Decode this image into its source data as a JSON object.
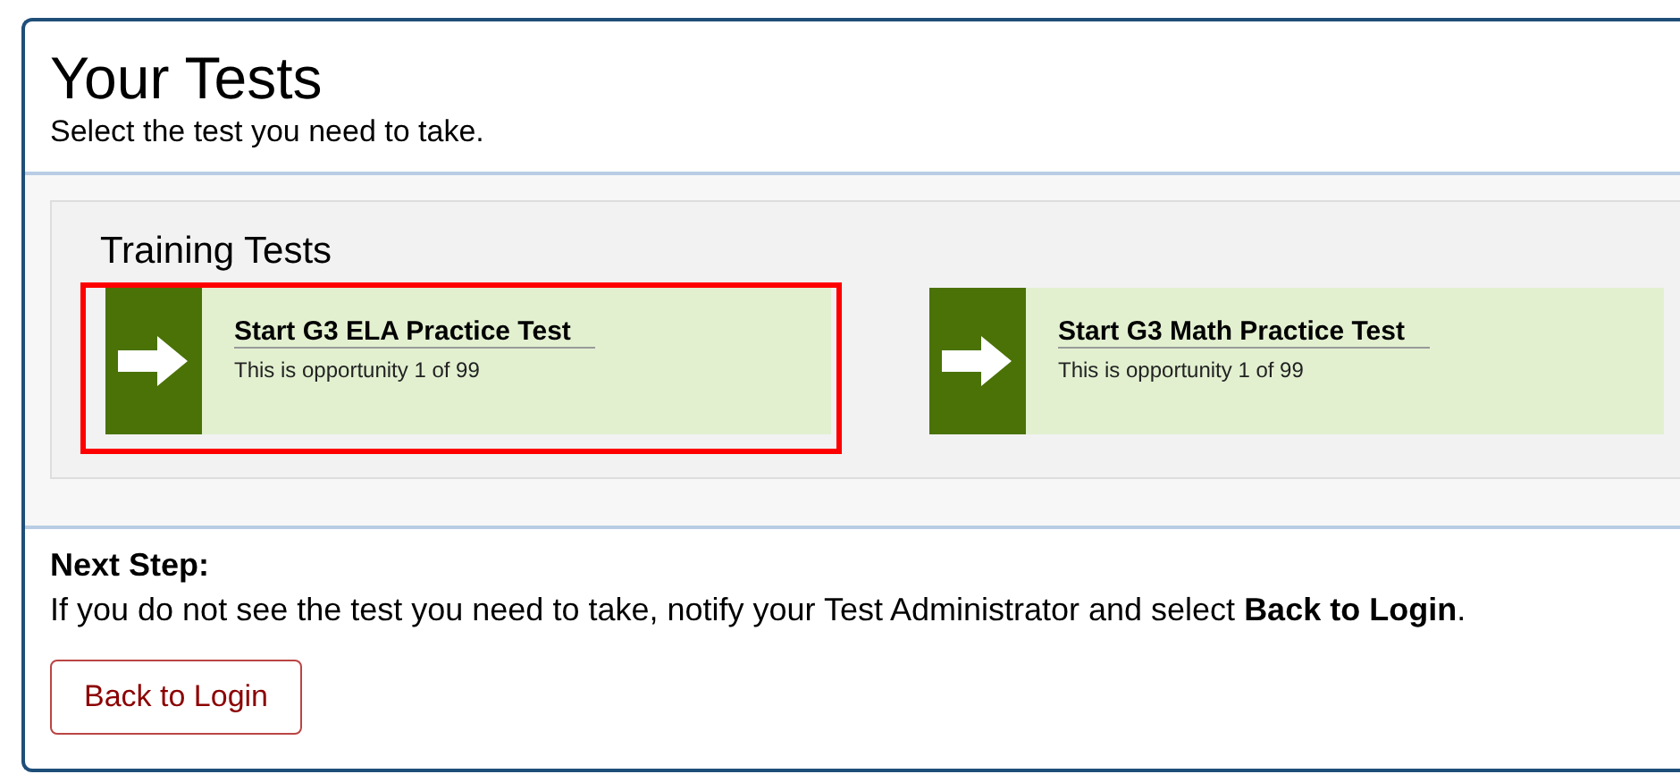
{
  "header": {
    "title": "Your Tests",
    "subtitle": "Select the test you need to take."
  },
  "section": {
    "title": "Training Tests"
  },
  "tests": [
    {
      "title": "Start G3 ELA Practice Test",
      "detail": "This is opportunity 1 of 99",
      "highlighted": true
    },
    {
      "title": "Start G3 Math Practice Test",
      "detail": "This is opportunity 1 of 99",
      "highlighted": false
    }
  ],
  "next_step": {
    "heading": "Next Step:",
    "text": "If you do not see the test you need to take, notify your Test Administrator and select **Back to Login**."
  },
  "buttons": [
    {
      "label": "Back to Login"
    }
  ]
}
